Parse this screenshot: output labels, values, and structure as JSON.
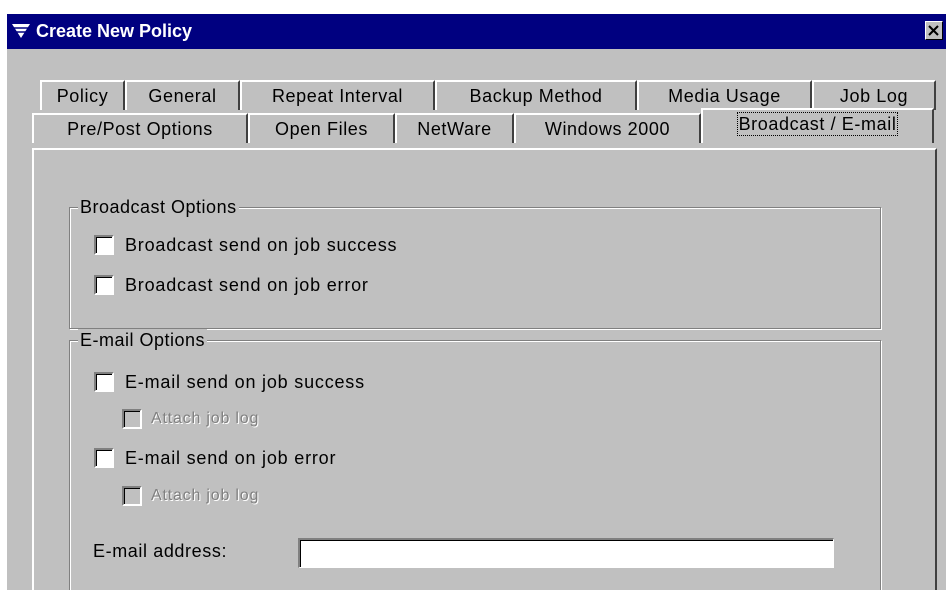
{
  "window": {
    "title": "Create New Policy",
    "colors": {
      "titlebar": "#000080",
      "face": "#c0c0c0",
      "disabled_text": "#808080"
    }
  },
  "icons": {
    "title": "filter-funnel-icon",
    "close": "close-icon"
  },
  "tabs": {
    "row1": [
      "Policy",
      "General",
      "Repeat Interval",
      "Backup Method",
      "Media Usage",
      "Job Log"
    ],
    "row2": [
      "Pre/Post Options",
      "Open Files",
      "NetWare",
      "Windows 2000",
      "Broadcast / E-mail"
    ],
    "active": "Broadcast / E-mail"
  },
  "broadcast": {
    "legend": "Broadcast Options",
    "send_success": {
      "label": "Broadcast send on job success",
      "checked": false
    },
    "send_error": {
      "label": "Broadcast send on job error",
      "checked": false
    }
  },
  "email": {
    "legend": "E-mail Options",
    "send_success": {
      "label": "E-mail send on job success",
      "checked": false
    },
    "attach_success": {
      "label": "Attach job log",
      "checked": false,
      "enabled": false
    },
    "send_error": {
      "label": "E-mail send on job error",
      "checked": false
    },
    "attach_error": {
      "label": "Attach job log",
      "checked": false,
      "enabled": false
    },
    "address_label": "E-mail address:",
    "address_value": ""
  }
}
